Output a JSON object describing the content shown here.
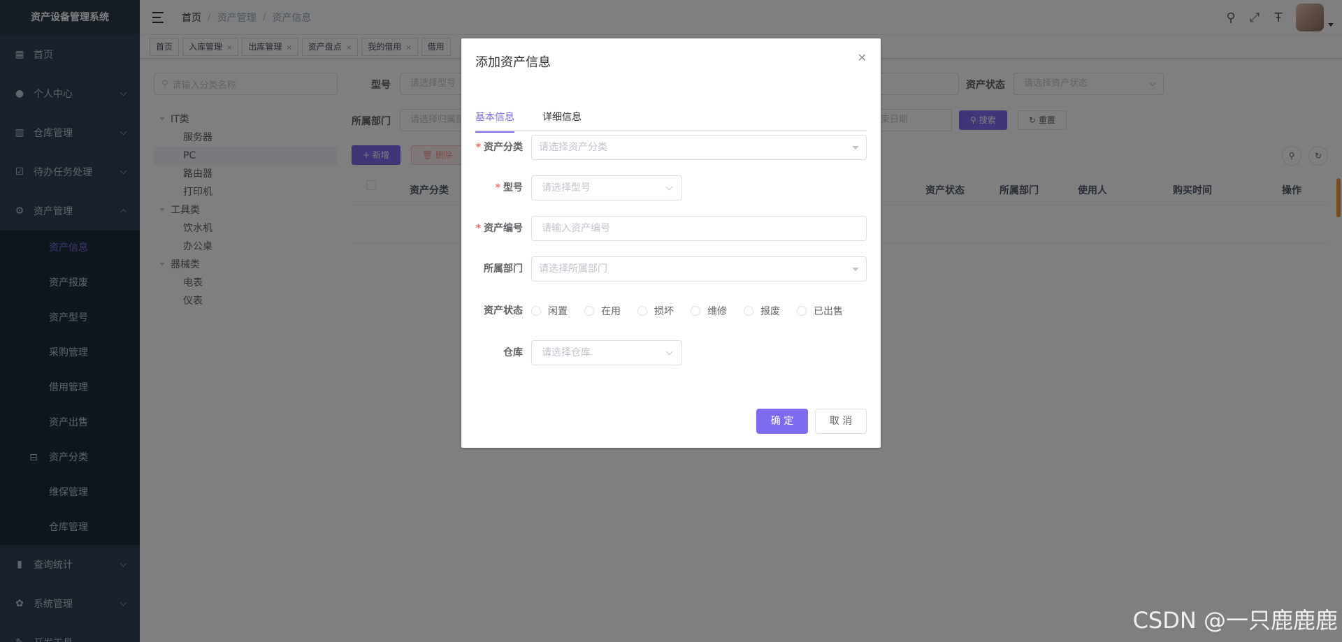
{
  "sidebar": {
    "title": "资产设备管理系统",
    "menu": [
      {
        "label": "首页",
        "icon": "dashboard-icon"
      },
      {
        "label": "个人中心",
        "icon": "user-icon"
      },
      {
        "label": "仓库管理",
        "icon": "warehouse-icon"
      },
      {
        "label": "待办任务处理",
        "icon": "task-icon"
      },
      {
        "label": "资产管理",
        "icon": "asset-icon"
      }
    ],
    "asset_sub": [
      "资产信息",
      "资产报废",
      "资产型号",
      "采购管理",
      "借用管理",
      "资产出售",
      "资产分类",
      "维保管理",
      "仓库管理"
    ],
    "bottom_menu": [
      {
        "label": "查询统计",
        "icon": "chart-icon"
      },
      {
        "label": "系统管理",
        "icon": "settings-icon"
      },
      {
        "label": "开发工具",
        "icon": "tool-icon"
      }
    ]
  },
  "breadcrumb": [
    "首页",
    "资产管理",
    "资产信息"
  ],
  "tags": [
    {
      "label": "首页",
      "closable": false
    },
    {
      "label": "入库管理",
      "closable": true
    },
    {
      "label": "出库管理",
      "closable": true
    },
    {
      "label": "资产盘点",
      "closable": true
    },
    {
      "label": "我的借用",
      "closable": true
    },
    {
      "label": "借用",
      "closable": false
    }
  ],
  "tree": {
    "search_placeholder": "请输入分类名称",
    "nodes": [
      {
        "label": "IT类",
        "level": 1
      },
      {
        "label": "服务器",
        "level": 2
      },
      {
        "label": "PC",
        "level": 2,
        "selected": true
      },
      {
        "label": "路由器",
        "level": 2
      },
      {
        "label": "打印机",
        "level": 2
      },
      {
        "label": "工具类",
        "level": 1
      },
      {
        "label": "饮水机",
        "level": 2
      },
      {
        "label": "办公桌",
        "level": 2
      },
      {
        "label": "器械类",
        "level": 1
      },
      {
        "label": "电表",
        "level": 2
      },
      {
        "label": "仪表",
        "level": 2
      }
    ]
  },
  "filters": {
    "model_label": "型号",
    "model_placeholder": "请选择型号",
    "status_label": "资产状态",
    "status_placeholder": "请选择资产状态",
    "dept_label": "所属部门",
    "dept_placeholder": "请选择归属部",
    "end_date_placeholder": "结束日期",
    "search_btn": "搜索",
    "reset_btn": "重置"
  },
  "toolbar": {
    "add": "新增",
    "delete": "删除"
  },
  "table_headers": [
    "资产分类",
    "资产状态",
    "所属部门",
    "使用人",
    "购买时间",
    "操作"
  ],
  "dialog": {
    "title": "添加资产信息",
    "tabs": [
      "基本信息",
      "详细信息"
    ],
    "fields": {
      "category_label": "资产分类",
      "category_placeholder": "请选择资产分类",
      "model_label": "型号",
      "model_placeholder": "请选择型号",
      "code_label": "资产编号",
      "code_placeholder": "请输入资产编号",
      "dept_label": "所属部门",
      "dept_placeholder": "请选择所属部门",
      "status_label": "资产状态",
      "status_options": [
        "闲置",
        "在用",
        "损坏",
        "维修",
        "报废",
        "已出售"
      ],
      "warehouse_label": "仓库",
      "warehouse_placeholder": "请选择仓库"
    },
    "ok": "确 定",
    "cancel": "取 消"
  },
  "watermark": "CSDN @一只鹿鹿鹿"
}
